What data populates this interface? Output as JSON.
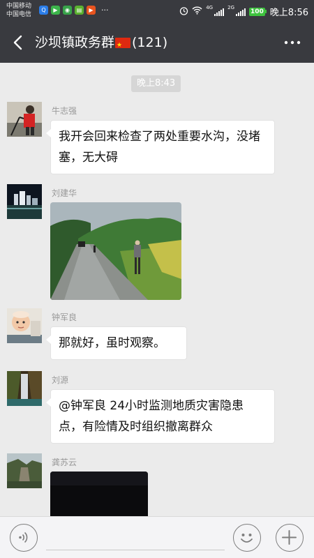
{
  "status_bar": {
    "carrier_1": "中国移动",
    "carrier_2": "中国电信",
    "network_a": "4G",
    "network_b": "2G",
    "battery": "100",
    "time": "晚上8:56",
    "more": "···"
  },
  "header": {
    "title": "沙坝镇政务群",
    "member_count": "(121)"
  },
  "chat": {
    "timestamp": "晚上8:43",
    "messages": [
      {
        "sender": "牛志强",
        "text": "我开会回来检查了两处重要水沟，没堵塞，无大碍"
      },
      {
        "sender": "刘建华",
        "type": "image"
      },
      {
        "sender": "钟军良",
        "text": "那就好，虽时观察。"
      },
      {
        "sender": "刘源",
        "text": "@钟军良 24小时监测地质灾害隐患点，有险情及时组织撤离群众"
      },
      {
        "sender": "龚苏云",
        "type": "image"
      }
    ]
  },
  "input_bar": {
    "text_value": ""
  },
  "colors": {
    "header_bg": "#393a3f",
    "chat_bg": "#ebebeb",
    "battery": "#3ec23e"
  }
}
